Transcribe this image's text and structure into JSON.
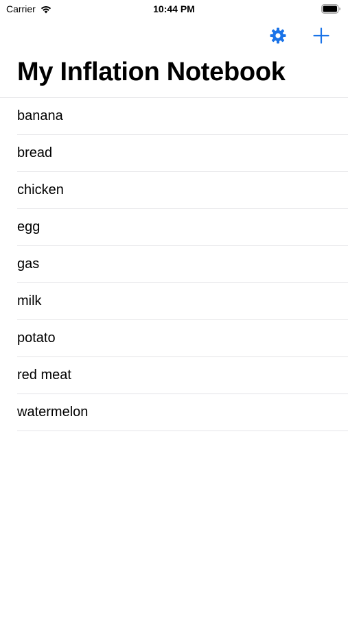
{
  "status_bar": {
    "carrier": "Carrier",
    "time": "10:44 PM",
    "wifi_icon": "wifi-icon",
    "battery_icon": "battery-full-icon"
  },
  "nav_bar": {
    "settings_icon": "gear-icon",
    "add_icon": "plus-icon",
    "accent_color": "#1a73e8"
  },
  "title": "My Inflation Notebook",
  "items": [
    {
      "label": "banana"
    },
    {
      "label": "bread"
    },
    {
      "label": "chicken"
    },
    {
      "label": "egg"
    },
    {
      "label": "gas"
    },
    {
      "label": "milk"
    },
    {
      "label": "potato"
    },
    {
      "label": "red meat"
    },
    {
      "label": "watermelon"
    }
  ]
}
